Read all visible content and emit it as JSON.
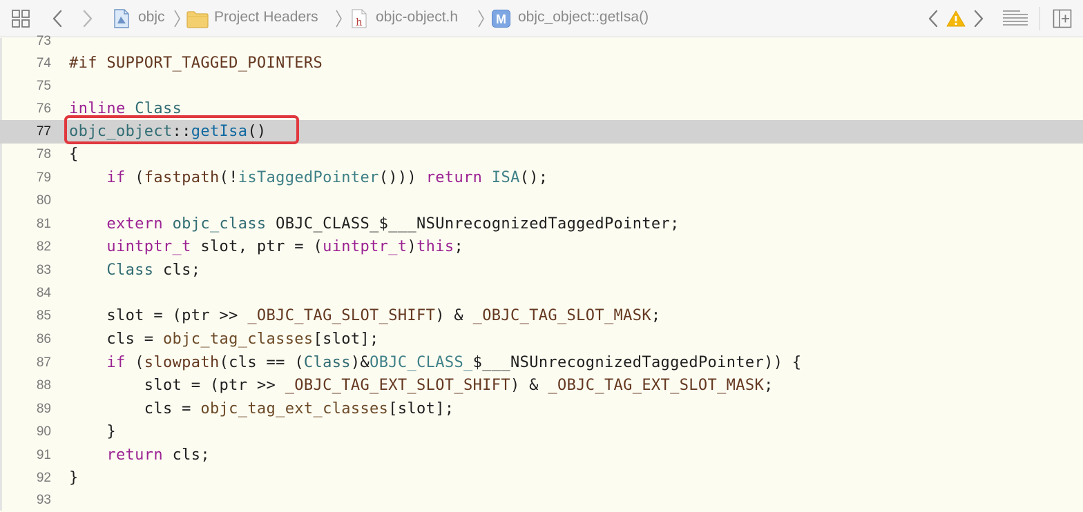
{
  "jumpbar": {
    "breadcrumbs": [
      {
        "label": "objc",
        "icon": "project-icon"
      },
      {
        "label": "Project Headers",
        "icon": "folder-icon"
      },
      {
        "label": "objc-object.h",
        "icon": "header-file-icon",
        "icon_letter": "h"
      },
      {
        "label": "objc_object::getIsa()",
        "icon": "method-icon",
        "icon_letter": "M"
      }
    ],
    "icons": [
      "related-items-icon",
      "back-icon",
      "forward-icon",
      "previous-issue-icon",
      "warning-icon",
      "next-issue-icon",
      "document-outline-icon",
      "add-editor-icon"
    ]
  },
  "editor": {
    "current_line": 77,
    "lines": [
      {
        "num": "73",
        "code": ""
      },
      {
        "num": "74",
        "code": "#if SUPPORT_TAGGED_POINTERS"
      },
      {
        "num": "75",
        "code": ""
      },
      {
        "num": "76",
        "code": "inline Class"
      },
      {
        "num": "77",
        "code": "objc_object::getIsa()"
      },
      {
        "num": "78",
        "code": "{"
      },
      {
        "num": "79",
        "code": "    if (fastpath(!isTaggedPointer())) return ISA();"
      },
      {
        "num": "80",
        "code": ""
      },
      {
        "num": "81",
        "code": "    extern objc_class OBJC_CLASS_$___NSUnrecognizedTaggedPointer;"
      },
      {
        "num": "82",
        "code": "    uintptr_t slot, ptr = (uintptr_t)this;"
      },
      {
        "num": "83",
        "code": "    Class cls;"
      },
      {
        "num": "84",
        "code": ""
      },
      {
        "num": "85",
        "code": "    slot = (ptr >> _OBJC_TAG_SLOT_SHIFT) & _OBJC_TAG_SLOT_MASK;"
      },
      {
        "num": "86",
        "code": "    cls = objc_tag_classes[slot];"
      },
      {
        "num": "87",
        "code": "    if (slowpath(cls == (Class)&OBJC_CLASS_$___NSUnrecognizedTaggedPointer)) {"
      },
      {
        "num": "88",
        "code": "        slot = (ptr >> _OBJC_TAG_EXT_SLOT_SHIFT) & _OBJC_TAG_EXT_SLOT_MASK;"
      },
      {
        "num": "89",
        "code": "        cls = objc_tag_ext_classes[slot];"
      },
      {
        "num": "90",
        "code": "    }"
      },
      {
        "num": "91",
        "code": "    return cls;"
      },
      {
        "num": "92",
        "code": "}"
      },
      {
        "num": "93",
        "code": ""
      }
    ]
  },
  "colors": {
    "editor_background": "#fdfcf1",
    "current_line_background": "#d2d2d2",
    "highlight_border": "#e0383e",
    "keyword": "#9b2393",
    "warning": "#f5b80a"
  }
}
